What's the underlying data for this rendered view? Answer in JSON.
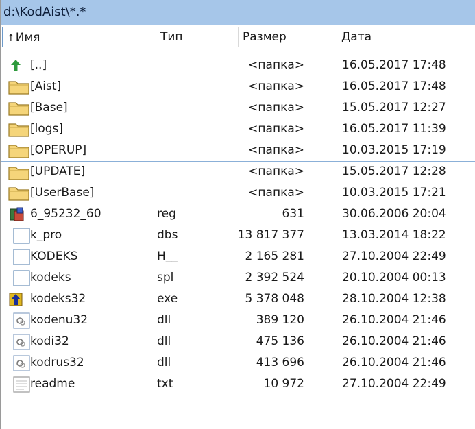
{
  "path": "d:\\KodAist\\*.*",
  "columns": {
    "name": "Имя",
    "sort_arrow": "↑",
    "type": "Тип",
    "size": "Размер",
    "date": "Дата"
  },
  "files": [
    {
      "name": "[..]",
      "type": "",
      "size": "<папка>",
      "date": "16.05.2017 17:48",
      "icon": "up-arrow-icon"
    },
    {
      "name": "[Aist]",
      "type": "",
      "size": "<папка>",
      "date": "16.05.2017 17:48",
      "icon": "folder-icon"
    },
    {
      "name": "[Base]",
      "type": "",
      "size": "<папка>",
      "date": "15.05.2017 12:27",
      "icon": "folder-icon"
    },
    {
      "name": "[logs]",
      "type": "",
      "size": "<папка>",
      "date": "16.05.2017 11:39",
      "icon": "folder-icon"
    },
    {
      "name": "[OPERUP]",
      "type": "",
      "size": "<папка>",
      "date": "10.03.2015 17:19",
      "icon": "folder-icon"
    },
    {
      "name": "[UPDATE]",
      "type": "",
      "size": "<папка>",
      "date": "15.05.2017 12:28",
      "icon": "folder-icon",
      "selected": true
    },
    {
      "name": "[UserBase]",
      "type": "",
      "size": "<папка>",
      "date": "10.03.2015 17:21",
      "icon": "folder-icon"
    },
    {
      "name": "6_95232_60",
      "type": "reg",
      "size": "631",
      "date": "30.06.2006 20:04",
      "icon": "registry-icon"
    },
    {
      "name": "k_pro",
      "type": "dbs",
      "size": "13 817 377",
      "date": "13.03.2014 18:22",
      "icon": "file-icon"
    },
    {
      "name": "KODEKS",
      "type": "H__",
      "size": "2 165 281",
      "date": "27.10.2004 22:49",
      "icon": "file-icon"
    },
    {
      "name": "kodeks",
      "type": "spl",
      "size": "2 392 524",
      "date": "20.10.2004 00:13",
      "icon": "file-icon"
    },
    {
      "name": "kodeks32",
      "type": "exe",
      "size": "5 378 048",
      "date": "28.10.2004 12:38",
      "icon": "app-icon"
    },
    {
      "name": "kodenu32",
      "type": "dll",
      "size": "389 120",
      "date": "26.10.2004 21:46",
      "icon": "dll-icon"
    },
    {
      "name": "kodi32",
      "type": "dll",
      "size": "475 136",
      "date": "26.10.2004 21:46",
      "icon": "dll-icon"
    },
    {
      "name": "kodrus32",
      "type": "dll",
      "size": "413 696",
      "date": "26.10.2004 21:46",
      "icon": "dll-icon"
    },
    {
      "name": "readme",
      "type": "txt",
      "size": "10 972",
      "date": "27.10.2004 22:49",
      "icon": "text-file-icon"
    }
  ]
}
